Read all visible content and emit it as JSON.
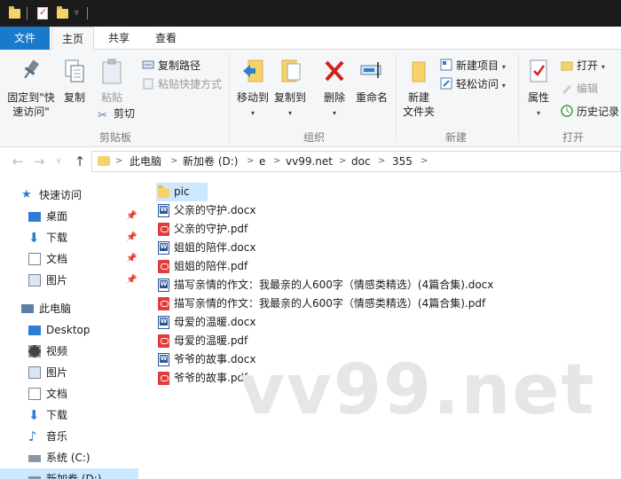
{
  "titlebar": {
    "quick_access": [
      "folder-icon",
      "properties-icon",
      "new-folder-icon",
      "customize-arrow"
    ]
  },
  "tabs": [
    {
      "label": "文件"
    },
    {
      "label": "主页"
    },
    {
      "label": "共享"
    },
    {
      "label": "查看"
    }
  ],
  "ribbon": {
    "clipboard": {
      "pin_label_1": "固定到\"快",
      "pin_label_2": "速访问\"",
      "copy_label": "复制",
      "paste_label": "粘贴",
      "copy_path": "复制路径",
      "paste_shortcut": "粘贴快捷方式",
      "cut": "剪切",
      "group": "剪贴板"
    },
    "organize": {
      "move_to": "移动到",
      "copy_to": "复制到",
      "delete": "删除",
      "rename": "重命名",
      "group": "组织"
    },
    "new": {
      "new_folder_1": "新建",
      "new_folder_2": "文件夹",
      "new_item": "新建项目",
      "easy_access": "轻松访问",
      "group": "新建"
    },
    "open": {
      "properties": "属性",
      "open": "打开",
      "edit": "编辑",
      "history": "历史记录",
      "group": "打开"
    }
  },
  "address": {
    "crumbs": [
      "此电脑",
      "新加卷 (D:)",
      "e",
      "vv99.net",
      "doc",
      "355"
    ]
  },
  "navpane": {
    "quick_access": "快速访问",
    "qa_items": [
      {
        "label": "桌面"
      },
      {
        "label": "下载"
      },
      {
        "label": "文档"
      },
      {
        "label": "图片"
      }
    ],
    "this_pc": "此电脑",
    "pc_items": [
      {
        "label": "Desktop"
      },
      {
        "label": "视频"
      },
      {
        "label": "图片"
      },
      {
        "label": "文档"
      },
      {
        "label": "下载"
      },
      {
        "label": "音乐"
      },
      {
        "label": "系统 (C:)"
      },
      {
        "label": "新加卷 (D:)"
      }
    ]
  },
  "files": [
    {
      "name": "pic",
      "type": "folder"
    },
    {
      "name": "父亲的守护.docx",
      "type": "docx"
    },
    {
      "name": "父亲的守护.pdf",
      "type": "pdf"
    },
    {
      "name": "姐姐的陪伴.docx",
      "type": "docx"
    },
    {
      "name": "姐姐的陪伴.pdf",
      "type": "pdf"
    },
    {
      "name": "描写亲情的作文：我最亲的人600字（情感类精选）(4篇合集).docx",
      "type": "docx"
    },
    {
      "name": "描写亲情的作文：我最亲的人600字（情感类精选）(4篇合集).pdf",
      "type": "pdf"
    },
    {
      "name": "母爱的温暖.docx",
      "type": "docx"
    },
    {
      "name": "母爱的温暖.pdf",
      "type": "pdf"
    },
    {
      "name": "爷爷的故事.docx",
      "type": "docx"
    },
    {
      "name": "爷爷的故事.pdf",
      "type": "pdf"
    }
  ],
  "watermark": "vv99.net",
  "colors": {
    "accent": "#1979ca",
    "selection": "#cce8ff",
    "titlebar": "#1b1b1b",
    "ribbon_bg": "#f5f6f7"
  }
}
